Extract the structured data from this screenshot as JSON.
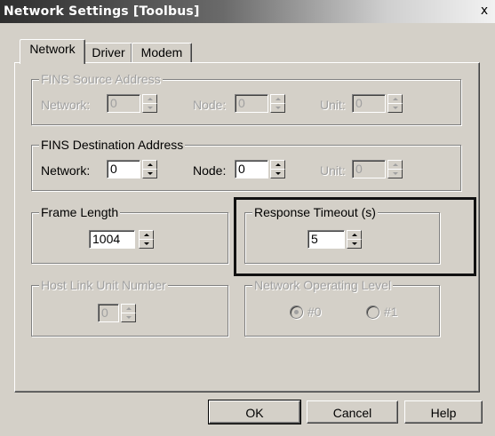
{
  "window": {
    "title": "Network Settings [Toolbus]",
    "close_glyph": "x"
  },
  "tabs": [
    {
      "label": "Network",
      "active": true
    },
    {
      "label": "Driver",
      "active": false
    },
    {
      "label": "Modem",
      "active": false
    }
  ],
  "fins_source": {
    "title": "FINS Source Address",
    "network_label": "Network:",
    "network_value": "0",
    "node_label": "Node:",
    "node_value": "0",
    "unit_label": "Unit:",
    "unit_value": "0"
  },
  "fins_dest": {
    "title": "FINS Destination Address",
    "network_label": "Network:",
    "network_value": "0",
    "node_label": "Node:",
    "node_value": "0",
    "unit_label": "Unit:",
    "unit_value": "0"
  },
  "frame_length": {
    "title": "Frame Length",
    "value": "1004"
  },
  "response_timeout": {
    "title": "Response Timeout (s)",
    "value": "5"
  },
  "host_link": {
    "title": "Host Link Unit Number",
    "value": "0"
  },
  "op_level": {
    "title": "Network Operating Level",
    "options": [
      {
        "label": "#0",
        "selected": true
      },
      {
        "label": "#1",
        "selected": false
      }
    ]
  },
  "buttons": {
    "ok": "OK",
    "cancel": "Cancel",
    "help": "Help"
  }
}
